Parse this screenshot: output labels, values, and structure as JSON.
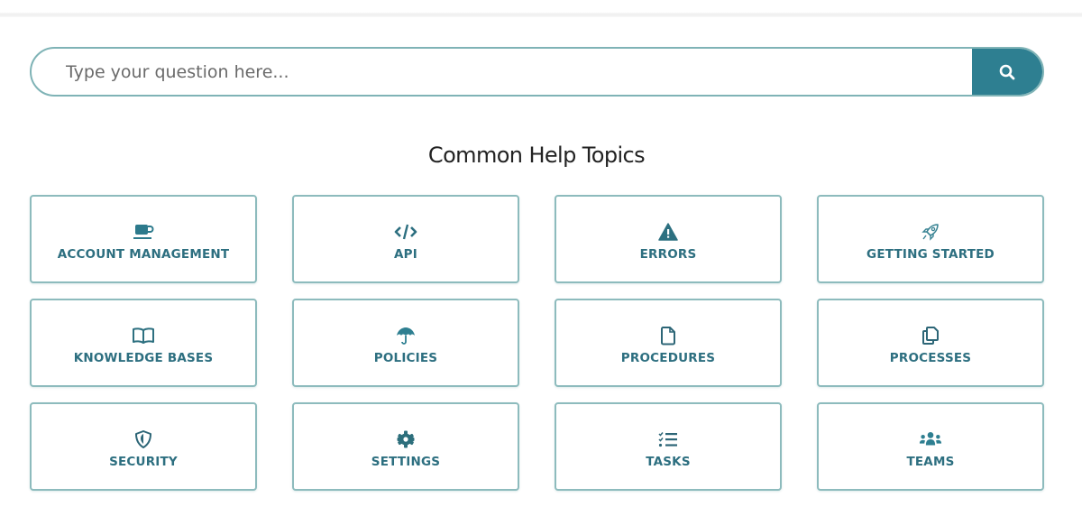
{
  "search": {
    "placeholder": "Type your question here...",
    "value": "",
    "button_icon": "search-icon"
  },
  "section_title": "Common Help Topics",
  "colors": {
    "accent": "#2e7f91",
    "card_border": "#8dbbbd",
    "label": "#2d6f80"
  },
  "topics": [
    {
      "label": "ACCOUNT MANAGEMENT",
      "icon": "coffee-cup-icon"
    },
    {
      "label": "API",
      "icon": "code-icon"
    },
    {
      "label": "ERRORS",
      "icon": "warning-triangle-icon"
    },
    {
      "label": "GETTING STARTED",
      "icon": "rocket-icon"
    },
    {
      "label": "KNOWLEDGE BASES",
      "icon": "open-book-icon"
    },
    {
      "label": "POLICIES",
      "icon": "umbrella-icon"
    },
    {
      "label": "PROCEDURES",
      "icon": "file-icon"
    },
    {
      "label": "PROCESSES",
      "icon": "copy-files-icon"
    },
    {
      "label": "SECURITY",
      "icon": "shield-icon"
    },
    {
      "label": "SETTINGS",
      "icon": "gear-icon"
    },
    {
      "label": "TASKS",
      "icon": "task-list-icon"
    },
    {
      "label": "TEAMS",
      "icon": "users-group-icon"
    }
  ]
}
